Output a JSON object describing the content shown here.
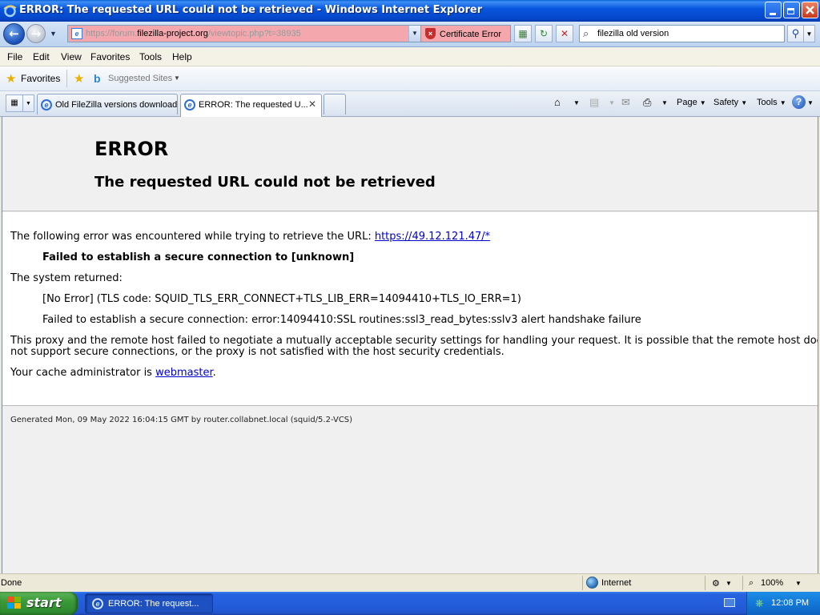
{
  "window": {
    "title": "ERROR: The requested URL could not be retrieved - Windows Internet Explorer"
  },
  "address_bar": {
    "url_prefix": "https://forum.",
    "url_host": "filezilla-project.org",
    "url_suffix": "/viewtopic.php?t=38935",
    "cert_error_label": "Certificate Error",
    "search_query": "filezilla old version"
  },
  "menu": {
    "items": [
      "File",
      "Edit",
      "View",
      "Favorites",
      "Tools",
      "Help"
    ]
  },
  "favorites_bar": {
    "favorites_label": "Favorites",
    "suggested_label": "Suggested Sites"
  },
  "tabs": [
    {
      "label": "Old FileZilla versions download"
    },
    {
      "label": "ERROR: The requested U..."
    }
  ],
  "command_bar": {
    "page_label": "Page",
    "safety_label": "Safety",
    "tools_label": "Tools"
  },
  "page": {
    "heading": "ERROR",
    "subheading": "The requested URL could not be retrieved",
    "line1_text": "The following error was encountered while trying to retrieve the URL: ",
    "line1_link": "https://49.12.121.47/*",
    "error_reason": "Failed to establish a secure connection to [unknown]",
    "system_returned": "The system returned:",
    "sys_line1": "[No Error] (TLS code: SQUID_TLS_ERR_CONNECT+TLS_LIB_ERR=14094410+TLS_IO_ERR=1)",
    "sys_line2": "Failed to establish a secure connection: error:14094410:SSL routines:ssl3_read_bytes:sslv3 alert handshake failure",
    "proxy_line1": "This proxy and the remote host failed to negotiate a mutually acceptable security settings for handling your request. It is possible that the remote host does",
    "proxy_line2": "not support secure connections, or the proxy is not satisfied with the host security credentials.",
    "admin_text": "Your cache administrator is ",
    "admin_link": "webmaster",
    "admin_end": ".",
    "footer": "Generated Mon, 09 May 2022 16:04:15 GMT by router.collabnet.local (squid/5.2-VCS)"
  },
  "status_bar": {
    "status": "Done",
    "zone": "Internet",
    "zoom": "100%"
  },
  "taskbar": {
    "start_label": "start",
    "task_label": "ERROR: The request...",
    "clock": "12:08 PM"
  },
  "colors": {
    "titlebar": "#0855dd",
    "cert_error_bg": "#f4a8ae",
    "link": "#0000cc",
    "start_green": "#3c9a3a",
    "taskbar_blue": "#245edb"
  }
}
